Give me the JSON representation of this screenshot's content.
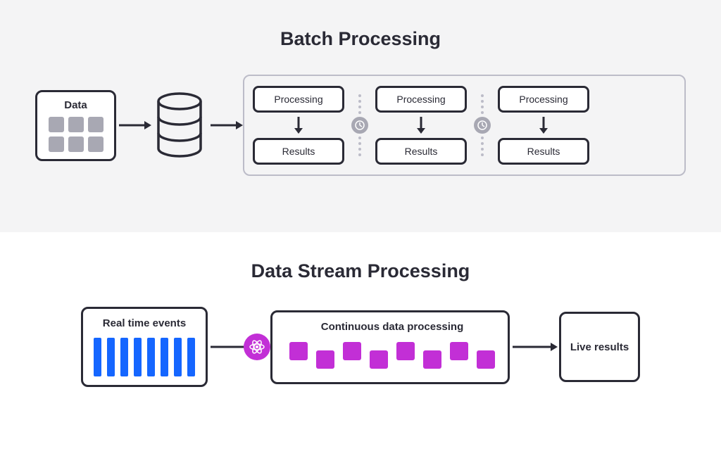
{
  "batch": {
    "title": "Batch Processing",
    "data_label": "Data",
    "steps": [
      {
        "top": "Processing",
        "bottom": "Results"
      },
      {
        "top": "Processing",
        "bottom": "Results"
      },
      {
        "top": "Processing",
        "bottom": "Results"
      }
    ]
  },
  "stream": {
    "title": "Data Stream Processing",
    "events_label": "Real time events",
    "continuous_label": "Continuous data processing",
    "live_label": "Live results"
  }
}
